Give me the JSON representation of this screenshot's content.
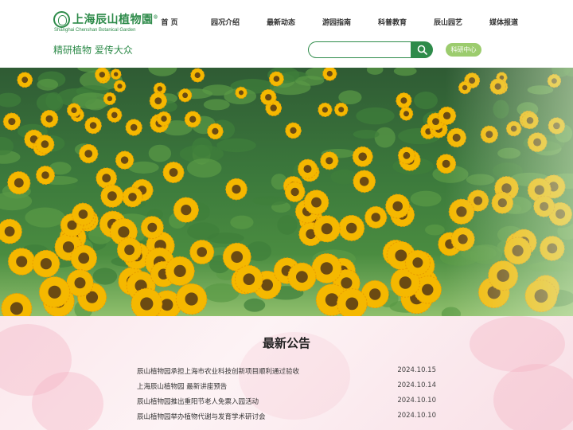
{
  "header": {
    "logo_cn": "上海辰山植物園",
    "logo_mark": "®",
    "logo_en": "Shanghai Chenshan Botanical Garden",
    "slogan": "精研植物 爱传大众"
  },
  "nav": {
    "items": [
      {
        "label": "首 页"
      },
      {
        "label": "园况介绍"
      },
      {
        "label": "最新动态"
      },
      {
        "label": "游园指南"
      },
      {
        "label": "科普教育"
      },
      {
        "label": "辰山园艺"
      },
      {
        "label": "媒体报道"
      }
    ]
  },
  "search": {
    "placeholder": "",
    "value": "",
    "icon": "search-icon"
  },
  "research_center": {
    "label": "科研中心"
  },
  "notice": {
    "title": "最新公告",
    "items": [
      {
        "text": "辰山植物园承担上海市农业科技创新项目顺利通过验收",
        "date": "2024.10.15"
      },
      {
        "text": "上海辰山植物园 最新讲座预告",
        "date": "2024.10.14"
      },
      {
        "text": "辰山植物园推出重阳节老人免票入园活动",
        "date": "2024.10.10"
      },
      {
        "text": "辰山植物园举办植物代谢与发育学术研讨会",
        "date": "2024.10.10"
      }
    ]
  },
  "colors": {
    "brand_green": "#2e8b4a",
    "accent_light_green": "#9ccc6e",
    "sunflower_yellow": "#f5b800"
  }
}
